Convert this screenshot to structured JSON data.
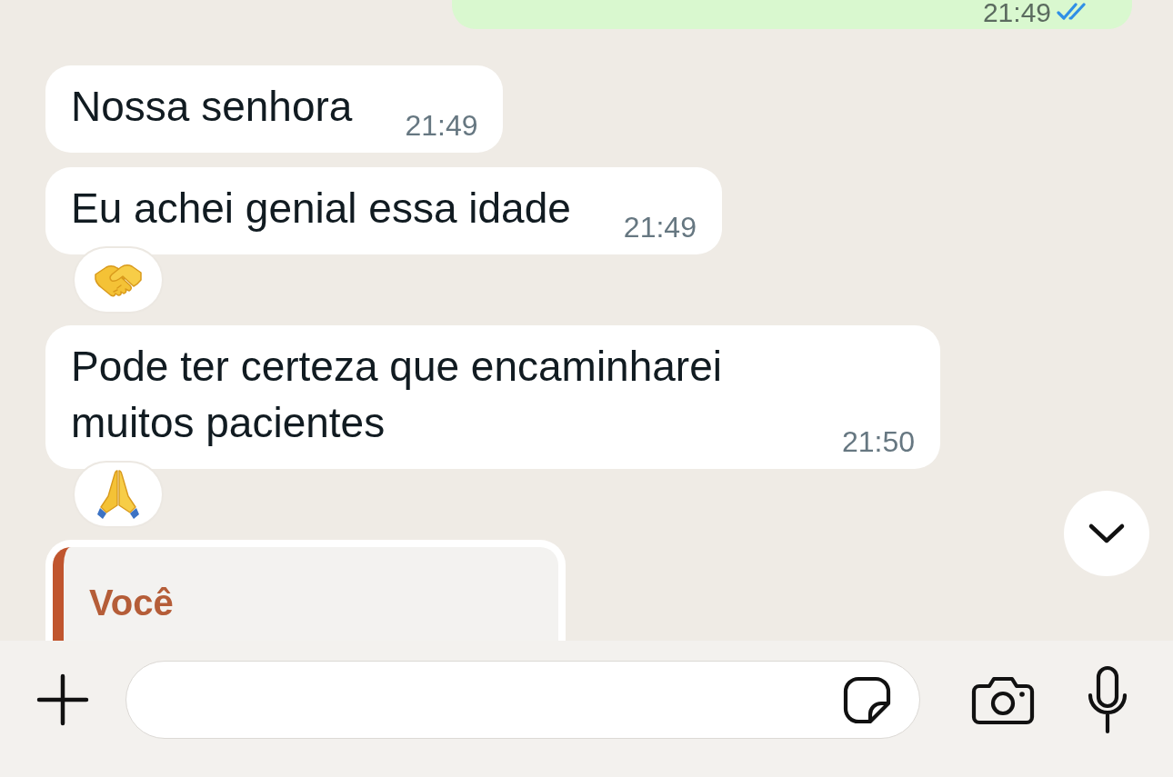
{
  "messages": [
    {
      "kind": "outgoing",
      "time": "21:49",
      "read": true
    },
    {
      "kind": "incoming",
      "text": "Nossa senhora",
      "time": "21:49"
    },
    {
      "kind": "incoming",
      "text": "Eu achei genial essa idade",
      "time": "21:49",
      "reaction": {
        "kind": "handshake"
      }
    },
    {
      "kind": "incoming",
      "text": "Pode ter certeza que encaminharei muitos pacientes",
      "time": "21:50",
      "reaction": {
        "kind": "folded-hands"
      }
    },
    {
      "kind": "reply",
      "quote": {
        "author": "Você"
      }
    }
  ]
}
